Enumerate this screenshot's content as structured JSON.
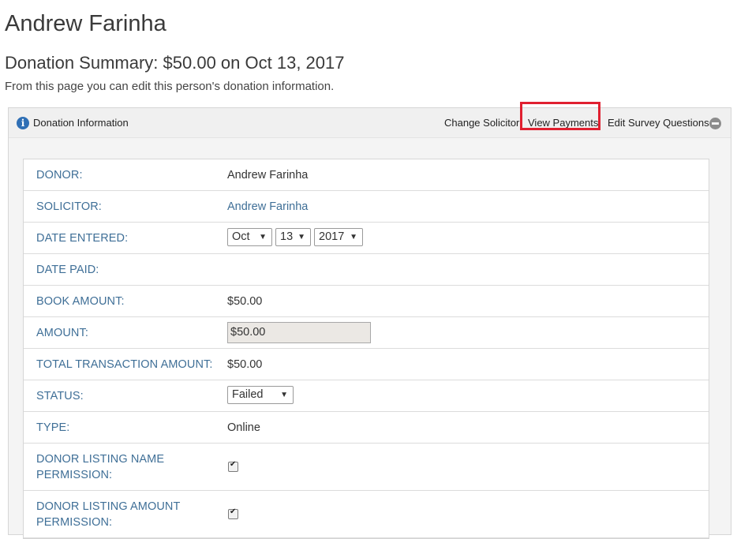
{
  "page": {
    "person_name": "Andrew Farinha",
    "summary_title": "Donation Summary: $50.00 on Oct 13, 2017",
    "intro": "From this page you can edit this person's donation information."
  },
  "panel": {
    "title": "Donation Information",
    "links": {
      "change_solicitor": "Change Solicitor",
      "view_payments": "View Payments",
      "edit_survey": "Edit Survey Questions"
    },
    "highlight_color": "#e02030"
  },
  "fields": {
    "donor": {
      "label": "DONOR:",
      "value": "Andrew Farinha"
    },
    "solicitor": {
      "label": "SOLICITOR:",
      "value": "Andrew Farinha"
    },
    "date_entered": {
      "label": "DATE ENTERED:",
      "month": "Oct",
      "day": "13",
      "year": "2017"
    },
    "date_paid": {
      "label": "DATE PAID:"
    },
    "book_amount": {
      "label": "BOOK AMOUNT:",
      "value": "$50.00"
    },
    "amount": {
      "label": "AMOUNT:",
      "value": "$50.00"
    },
    "total_transaction_amount": {
      "label": "TOTAL TRANSACTION AMOUNT:",
      "value": "$50.00"
    },
    "status": {
      "label": "STATUS:",
      "value": "Failed"
    },
    "type": {
      "label": "TYPE:",
      "value": "Online"
    },
    "donor_listing_name_permission": {
      "label_line1": "DONOR LISTING NAME",
      "label_line2": "PERMISSION:",
      "checked": true
    },
    "donor_listing_amount_permission": {
      "label_line1": "DONOR LISTING AMOUNT",
      "label_line2": "PERMISSION:",
      "checked": true
    }
  },
  "colors": {
    "label": "#3f6f97",
    "link": "#3f6f97",
    "info_icon": "#2f6fb5"
  },
  "icons": {
    "info": "info-icon",
    "collapse": "minus-circle-icon",
    "dropdown": "triangle-down-icon",
    "check": "checkmark-icon"
  }
}
